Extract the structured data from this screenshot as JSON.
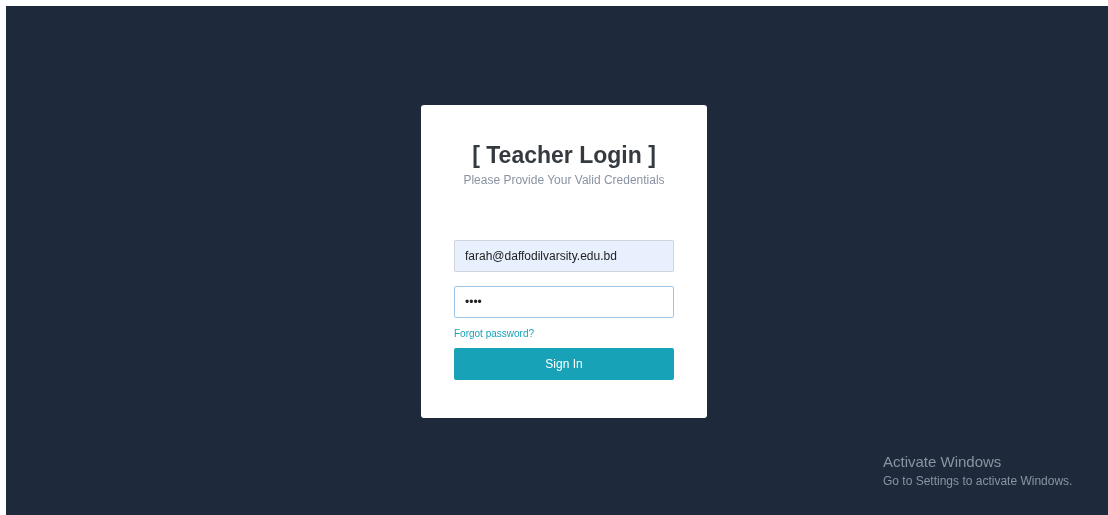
{
  "login_card": {
    "title": "[ Teacher Login ]",
    "subtitle": "Please Provide Your Valid Credentials",
    "email_field": {
      "value": "farah@daffodilvarsity.edu.bd",
      "autofilled": true
    },
    "password_field": {
      "value": "••••",
      "focused": true
    },
    "forgot_link": "Forgot password?",
    "sign_in_button": "Sign In"
  },
  "activation_notice": {
    "title": "Activate Windows",
    "message": "Go to Settings to activate Windows."
  }
}
